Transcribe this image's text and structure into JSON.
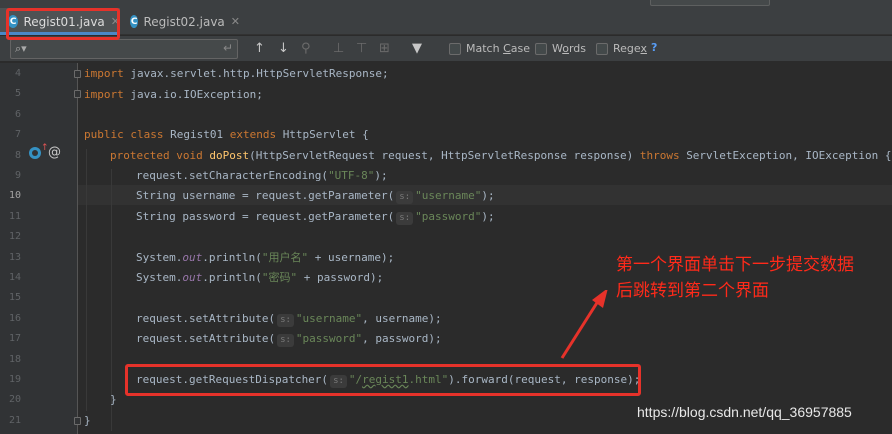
{
  "tabs": [
    {
      "label": "Regist01.java",
      "icon": "c-class-icon",
      "active": true
    },
    {
      "label": "Regist02.java",
      "icon": "c-class-icon",
      "active": false
    }
  ],
  "find": {
    "value": "",
    "options": {
      "match_case_pre": "Match ",
      "match_case_u": "C",
      "match_case_post": "ase",
      "words_pre": "W",
      "words_u": "o",
      "words_post": "rds",
      "regex_pre": "Rege",
      "regex_u": "x",
      "regex_post": ""
    },
    "help": "?"
  },
  "line_numbers": [
    "4",
    "5",
    "6",
    "7",
    "8",
    "9",
    "10",
    "11",
    "12",
    "13",
    "14",
    "15",
    "16",
    "17",
    "18",
    "19",
    "20",
    "21"
  ],
  "current_line": "10",
  "code": {
    "l4_kw": "import ",
    "l4_rest": "javax.servlet.http.HttpServletResponse;",
    "l5_kw": "import ",
    "l5_rest": "java.io.IOException;",
    "l7_kw": "public class ",
    "l7_name": "Regist01 ",
    "l7_kw2": "extends ",
    "l7_rest": "HttpServlet {",
    "l8_kw": "protected void ",
    "l8_fn": "doPost",
    "l8_mid": "(HttpServletRequest request, HttpServletResponse response) ",
    "l8_kw2": "throws ",
    "l8_rest": "ServletException, IOException {",
    "l9_a": "request.setCharacterEncoding(",
    "l9_s": "\"UTF-8\"",
    "l9_b": ");",
    "l10_a": "String username = request.getParameter(",
    "l10_h": "s:",
    "l10_s": "\"username\"",
    "l10_b": ");",
    "l11_a": "String password = request.getParameter(",
    "l11_h": "s:",
    "l11_s": "\"password\"",
    "l11_b": ");",
    "l13_a": "System.",
    "l13_st": "out",
    "l13_b": ".println(",
    "l13_s": "\"用户名\"",
    "l13_c": " + username);",
    "l14_a": "System.",
    "l14_st": "out",
    "l14_b": ".println(",
    "l14_s": "\"密码\"",
    "l14_c": " + password);",
    "l16_a": "request.setAttribute(",
    "l16_h": "s:",
    "l16_s": "\"username\"",
    "l16_b": ", username);",
    "l17_a": "request.setAttribute(",
    "l17_h": "s:",
    "l17_s": "\"password\"",
    "l17_b": ", password);",
    "l19_a": "request.getRequestDispatcher(",
    "l19_h": "s:",
    "l19_s1": "\"/",
    "l19_s2": "regist1",
    "l19_s3": ".html\"",
    "l19_b": ").forward(request, response);",
    "l20": "}",
    "l21": "}"
  },
  "annotation": {
    "line1": "第一个界面单击下一步提交数据",
    "line2": "后跳转到第二个界面"
  },
  "watermark": "https://blog.csdn.net/qq_36957885",
  "colors": {
    "annotation": "#ff2a1a",
    "keyword": "#cc7832",
    "string": "#6a8759"
  }
}
